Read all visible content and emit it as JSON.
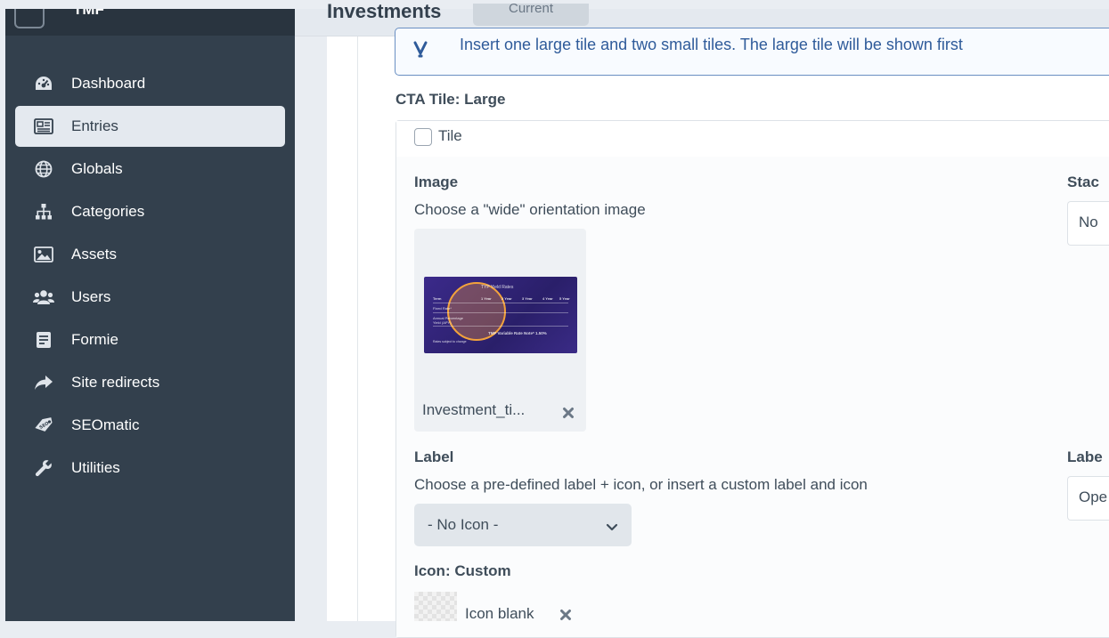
{
  "sidebar": {
    "site_name": "TMF",
    "items": [
      {
        "label": "Dashboard",
        "icon": "gauge-icon"
      },
      {
        "label": "Entries",
        "icon": "newspaper-icon"
      },
      {
        "label": "Globals",
        "icon": "globe-icon"
      },
      {
        "label": "Categories",
        "icon": "sitemap-icon"
      },
      {
        "label": "Assets",
        "icon": "image-icon"
      },
      {
        "label": "Users",
        "icon": "users-icon"
      },
      {
        "label": "Formie",
        "icon": "form-icon"
      },
      {
        "label": "Site redirects",
        "icon": "share-arrow-icon"
      },
      {
        "label": "SEOmatic",
        "icon": "seo-tag-icon"
      },
      {
        "label": "Utilities",
        "icon": "wrench-icon"
      }
    ],
    "active": "Entries"
  },
  "header": {
    "title": "Investments",
    "status": "Current"
  },
  "tip": {
    "text": "Insert one large tile and two small tiles. The large tile will be shown first"
  },
  "matrix": {
    "heading": "CTA Tile: Large",
    "block_type": "Tile",
    "image": {
      "label": "Image",
      "instructions": "Choose a \"wide\" orientation image",
      "filename": "Investment_ti...",
      "thumb_text": {
        "title": "TYP Yield Rates",
        "col_term": "Term",
        "col_1": "1 Year",
        "col_2": "2 Year",
        "col_3": "3 Year",
        "col_4": "4 Year",
        "col_5": "5 Year",
        "row_1": "Fixed Rate*",
        "row_2": "Annual Percentage Yield (APY)",
        "footer": "TMF Variable Rate Note* 1.50%",
        "fine_print": "Rates subject to change"
      }
    },
    "stack": {
      "label": "Stac",
      "value": "No"
    },
    "label_field": {
      "label": "Label",
      "instructions": "Choose a pre-defined label + icon, or insert a custom label and icon",
      "selected": "- No Icon -"
    },
    "label_text": {
      "label": "Labe",
      "value": "Ope"
    },
    "icon_custom": {
      "label": "Icon: Custom",
      "filename": "Icon blank"
    }
  },
  "colors": {
    "sidebar_bg": "#33404d",
    "active_item_bg": "#e4e9ef",
    "tip_border": "#6a8fc2",
    "tip_text": "#2f5b9a"
  }
}
